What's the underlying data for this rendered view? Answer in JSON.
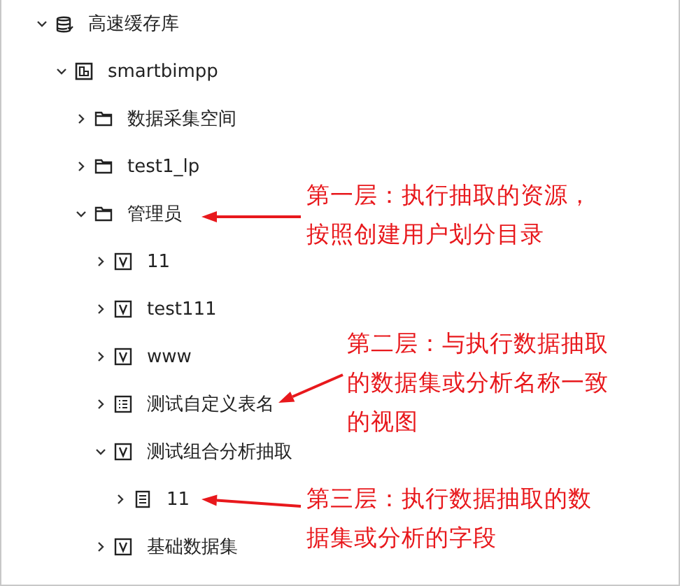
{
  "tree": [
    {
      "label": "高速缓存库",
      "kind": "database",
      "expanded": true,
      "children": [
        {
          "label": "smartbimpp",
          "kind": "schema",
          "expanded": true,
          "children": [
            {
              "label": "数据采集空间",
              "kind": "folder",
              "expanded": false
            },
            {
              "label": "test1_lp",
              "kind": "folder",
              "expanded": false
            },
            {
              "label": "管理员",
              "kind": "folder",
              "expanded": true,
              "children": [
                {
                  "label": "11",
                  "kind": "view",
                  "expanded": false
                },
                {
                  "label": "test111",
                  "kind": "view",
                  "expanded": false
                },
                {
                  "label": "www",
                  "kind": "view",
                  "expanded": false
                },
                {
                  "label": "测试自定义表名",
                  "kind": "table",
                  "expanded": false
                },
                {
                  "label": "测试组合分析抽取",
                  "kind": "view",
                  "expanded": true,
                  "children": [
                    {
                      "label": "11",
                      "kind": "fields",
                      "expanded": false
                    }
                  ]
                },
                {
                  "label": "基础数据集",
                  "kind": "view",
                  "expanded": false
                }
              ]
            }
          ]
        }
      ]
    }
  ],
  "annotations": [
    {
      "lines": [
        "第一层：执行抽取的资源，",
        "按照创建用户划分目录"
      ]
    },
    {
      "lines": [
        "第二层：与执行数据抽取",
        "的数据集或分析名称一致",
        "的视图"
      ]
    },
    {
      "lines": [
        "第三层：执行数据抽取的数",
        "据集或分析的字段"
      ]
    }
  ]
}
